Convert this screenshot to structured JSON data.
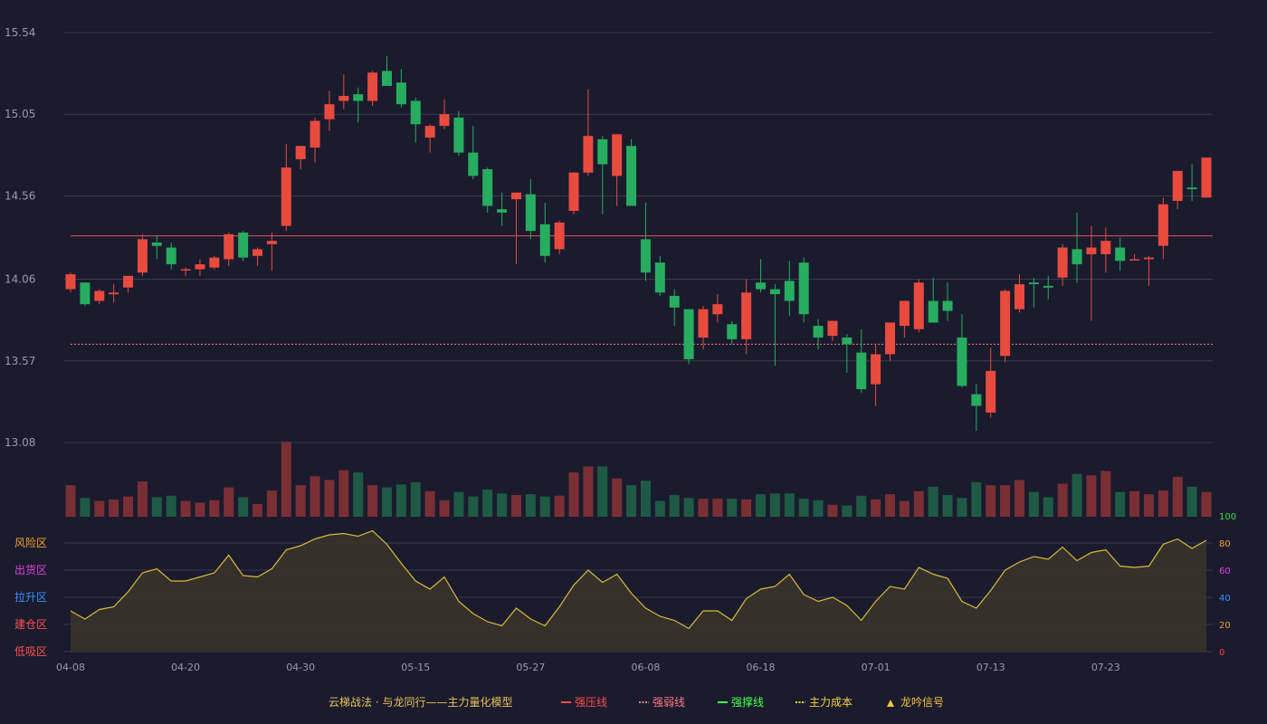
{
  "chart_data": {
    "type": "candlestick",
    "price_axis": {
      "ticks": [
        "15.54",
        "15.05",
        "14.56",
        "14.06",
        "13.57",
        "13.08"
      ],
      "range": [
        13.08,
        15.54
      ]
    },
    "x_tick_labels": [
      "04-08",
      "04-20",
      "04-30",
      "05-15",
      "05-27",
      "06-08",
      "06-18",
      "07-01",
      "07-13",
      "07-23"
    ],
    "x_tick_indices": [
      0,
      8,
      16,
      24,
      32,
      40,
      48,
      56,
      64,
      72
    ],
    "lines": {
      "strong_resistance": 14.32,
      "weak_resistance": 13.67
    },
    "candles": [
      {
        "o": 14.0,
        "h": 14.1,
        "l": 13.98,
        "c": 14.09
      },
      {
        "o": 14.04,
        "h": 14.04,
        "l": 13.9,
        "c": 13.91
      },
      {
        "o": 13.93,
        "h": 14.0,
        "l": 13.91,
        "c": 13.99
      },
      {
        "o": 13.97,
        "h": 14.03,
        "l": 13.92,
        "c": 13.98
      },
      {
        "o": 14.01,
        "h": 14.07,
        "l": 13.98,
        "c": 14.08
      },
      {
        "o": 14.1,
        "h": 14.33,
        "l": 14.08,
        "c": 14.3
      },
      {
        "o": 14.28,
        "h": 14.32,
        "l": 14.18,
        "c": 14.26
      },
      {
        "o": 14.25,
        "h": 14.28,
        "l": 14.12,
        "c": 14.15
      },
      {
        "o": 14.12,
        "h": 14.13,
        "l": 14.08,
        "c": 14.12
      },
      {
        "o": 14.12,
        "h": 14.18,
        "l": 14.08,
        "c": 14.15
      },
      {
        "o": 14.13,
        "h": 14.2,
        "l": 14.12,
        "c": 14.19
      },
      {
        "o": 14.18,
        "h": 14.34,
        "l": 14.14,
        "c": 14.33
      },
      {
        "o": 14.34,
        "h": 14.35,
        "l": 14.17,
        "c": 14.19
      },
      {
        "o": 14.2,
        "h": 14.25,
        "l": 14.14,
        "c": 14.24
      },
      {
        "o": 14.27,
        "h": 14.34,
        "l": 14.11,
        "c": 14.29
      },
      {
        "o": 14.38,
        "h": 14.87,
        "l": 14.35,
        "c": 14.73
      },
      {
        "o": 14.78,
        "h": 14.85,
        "l": 14.72,
        "c": 14.86
      },
      {
        "o": 14.85,
        "h": 15.03,
        "l": 14.76,
        "c": 15.01
      },
      {
        "o": 15.02,
        "h": 15.19,
        "l": 14.95,
        "c": 15.11
      },
      {
        "o": 15.13,
        "h": 15.29,
        "l": 15.08,
        "c": 15.16
      },
      {
        "o": 15.17,
        "h": 15.21,
        "l": 15.0,
        "c": 15.13
      },
      {
        "o": 15.13,
        "h": 15.31,
        "l": 15.1,
        "c": 15.3
      },
      {
        "o": 15.31,
        "h": 15.4,
        "l": 15.23,
        "c": 15.22
      },
      {
        "o": 15.24,
        "h": 15.32,
        "l": 15.09,
        "c": 15.11
      },
      {
        "o": 15.13,
        "h": 15.15,
        "l": 14.88,
        "c": 14.99
      },
      {
        "o": 14.91,
        "h": 14.99,
        "l": 14.82,
        "c": 14.98
      },
      {
        "o": 14.98,
        "h": 15.14,
        "l": 14.96,
        "c": 15.05
      },
      {
        "o": 15.03,
        "h": 15.07,
        "l": 14.8,
        "c": 14.82
      },
      {
        "o": 14.82,
        "h": 14.98,
        "l": 14.66,
        "c": 14.68
      },
      {
        "o": 14.72,
        "h": 14.73,
        "l": 14.46,
        "c": 14.5
      },
      {
        "o": 14.48,
        "h": 14.58,
        "l": 14.38,
        "c": 14.46
      },
      {
        "o": 14.54,
        "h": 14.58,
        "l": 14.15,
        "c": 14.58
      },
      {
        "o": 14.57,
        "h": 14.66,
        "l": 14.3,
        "c": 14.35
      },
      {
        "o": 14.39,
        "h": 14.52,
        "l": 14.16,
        "c": 14.2
      },
      {
        "o": 14.24,
        "h": 14.41,
        "l": 14.21,
        "c": 14.4
      },
      {
        "o": 14.47,
        "h": 14.7,
        "l": 14.45,
        "c": 14.7
      },
      {
        "o": 14.7,
        "h": 15.2,
        "l": 14.68,
        "c": 14.92
      },
      {
        "o": 14.9,
        "h": 14.92,
        "l": 14.45,
        "c": 14.75
      },
      {
        "o": 14.68,
        "h": 14.93,
        "l": 14.5,
        "c": 14.93
      },
      {
        "o": 14.86,
        "h": 14.9,
        "l": 14.5,
        "c": 14.5
      },
      {
        "o": 14.3,
        "h": 14.52,
        "l": 14.05,
        "c": 14.1
      },
      {
        "o": 14.16,
        "h": 14.2,
        "l": 13.96,
        "c": 13.98
      },
      {
        "o": 13.96,
        "h": 14.0,
        "l": 13.78,
        "c": 13.89
      },
      {
        "o": 13.88,
        "h": 13.88,
        "l": 13.55,
        "c": 13.58
      },
      {
        "o": 13.71,
        "h": 13.9,
        "l": 13.64,
        "c": 13.88
      },
      {
        "o": 13.85,
        "h": 13.97,
        "l": 13.8,
        "c": 13.91
      },
      {
        "o": 13.79,
        "h": 13.81,
        "l": 13.67,
        "c": 13.7
      },
      {
        "o": 13.7,
        "h": 14.06,
        "l": 13.61,
        "c": 13.98
      },
      {
        "o": 14.04,
        "h": 14.18,
        "l": 13.98,
        "c": 14.0
      },
      {
        "o": 14.0,
        "h": 14.03,
        "l": 13.54,
        "c": 13.97
      },
      {
        "o": 14.05,
        "h": 14.17,
        "l": 13.84,
        "c": 13.93
      },
      {
        "o": 14.16,
        "h": 14.19,
        "l": 13.8,
        "c": 13.85
      },
      {
        "o": 13.78,
        "h": 13.82,
        "l": 13.64,
        "c": 13.71
      },
      {
        "o": 13.72,
        "h": 13.81,
        "l": 13.69,
        "c": 13.81
      },
      {
        "o": 13.71,
        "h": 13.73,
        "l": 13.5,
        "c": 13.67
      },
      {
        "o": 13.62,
        "h": 13.76,
        "l": 13.38,
        "c": 13.4
      },
      {
        "o": 13.43,
        "h": 13.67,
        "l": 13.3,
        "c": 13.61
      },
      {
        "o": 13.61,
        "h": 13.8,
        "l": 13.57,
        "c": 13.8
      },
      {
        "o": 13.78,
        "h": 13.93,
        "l": 13.71,
        "c": 13.93
      },
      {
        "o": 13.76,
        "h": 14.06,
        "l": 13.74,
        "c": 14.04
      },
      {
        "o": 13.93,
        "h": 14.07,
        "l": 13.8,
        "c": 13.8
      },
      {
        "o": 13.93,
        "h": 14.04,
        "l": 13.81,
        "c": 13.87
      },
      {
        "o": 13.71,
        "h": 13.85,
        "l": 13.41,
        "c": 13.42
      },
      {
        "o": 13.37,
        "h": 13.43,
        "l": 13.15,
        "c": 13.3
      },
      {
        "o": 13.26,
        "h": 13.65,
        "l": 13.23,
        "c": 13.51
      },
      {
        "o": 13.6,
        "h": 14.0,
        "l": 13.56,
        "c": 13.99
      },
      {
        "o": 13.88,
        "h": 14.09,
        "l": 13.86,
        "c": 14.03
      },
      {
        "o": 14.04,
        "h": 14.07,
        "l": 13.89,
        "c": 14.03
      },
      {
        "o": 14.02,
        "h": 14.08,
        "l": 13.94,
        "c": 14.01
      },
      {
        "o": 14.07,
        "h": 14.27,
        "l": 14.02,
        "c": 14.25
      },
      {
        "o": 14.24,
        "h": 14.46,
        "l": 14.04,
        "c": 14.15
      },
      {
        "o": 14.21,
        "h": 14.38,
        "l": 13.81,
        "c": 14.25
      },
      {
        "o": 14.21,
        "h": 14.37,
        "l": 14.1,
        "c": 14.29
      },
      {
        "o": 14.25,
        "h": 14.31,
        "l": 14.11,
        "c": 14.17
      },
      {
        "o": 14.18,
        "h": 14.21,
        "l": 14.18,
        "c": 14.18
      },
      {
        "o": 14.18,
        "h": 14.2,
        "l": 14.02,
        "c": 14.19
      },
      {
        "o": 14.26,
        "h": 14.55,
        "l": 14.18,
        "c": 14.51
      },
      {
        "o": 14.53,
        "h": 14.66,
        "l": 14.48,
        "c": 14.71
      },
      {
        "o": 14.61,
        "h": 14.75,
        "l": 14.53,
        "c": 14.6
      },
      {
        "o": 14.55,
        "h": 14.75,
        "l": 14.55,
        "c": 14.79
      }
    ],
    "volume": [
      0.42,
      0.25,
      0.21,
      0.23,
      0.27,
      0.47,
      0.26,
      0.28,
      0.21,
      0.19,
      0.22,
      0.39,
      0.26,
      0.17,
      0.35,
      1.0,
      0.42,
      0.54,
      0.49,
      0.62,
      0.59,
      0.42,
      0.39,
      0.43,
      0.46,
      0.34,
      0.22,
      0.33,
      0.27,
      0.36,
      0.31,
      0.29,
      0.3,
      0.27,
      0.28,
      0.59,
      0.67,
      0.67,
      0.51,
      0.42,
      0.48,
      0.21,
      0.29,
      0.25,
      0.24,
      0.24,
      0.24,
      0.23,
      0.3,
      0.31,
      0.31,
      0.24,
      0.22,
      0.16,
      0.15,
      0.28,
      0.23,
      0.3,
      0.21,
      0.34,
      0.4,
      0.29,
      0.25,
      0.46,
      0.42,
      0.42,
      0.49,
      0.33,
      0.26,
      0.44,
      0.57,
      0.55,
      0.61,
      0.33,
      0.34,
      0.3,
      0.35,
      0.53,
      0.4,
      0.33,
      0.34
    ],
    "oscillator": {
      "axis_ticks": [
        "100",
        "80",
        "60",
        "40",
        "20",
        "0"
      ],
      "zones": [
        "风险区",
        "出货区",
        "拉升区",
        "建仓区",
        "低吸区"
      ],
      "values": [
        30,
        24,
        31,
        33,
        44,
        58,
        61,
        52,
        52,
        55,
        58,
        71,
        56,
        55,
        61,
        75,
        78,
        83,
        86,
        87,
        85,
        89,
        79,
        65,
        52,
        46,
        55,
        37,
        28,
        22,
        19,
        32,
        24,
        19,
        33,
        49,
        60,
        51,
        57,
        43,
        32,
        26,
        23,
        17,
        30,
        30,
        23,
        39,
        46,
        48,
        57,
        42,
        37,
        40,
        34,
        23,
        37,
        48,
        46,
        62,
        57,
        54,
        37,
        32,
        45,
        60,
        66,
        70,
        68,
        77,
        67,
        73,
        75,
        63,
        62,
        63,
        79,
        83,
        76,
        82
      ],
      "color": "#d9b93c"
    },
    "colors": {
      "up": "#e84b3e",
      "down": "#27ad5f",
      "vol_up": "#7a2f35",
      "vol_down": "#1e5a45"
    }
  },
  "legend": {
    "title": "云梯战法 · 与龙同行——主力量化模型",
    "items": [
      {
        "label": "强压线",
        "color": "#ff4d4d",
        "style": "solid"
      },
      {
        "label": "强弱线",
        "color": "#ff7a85",
        "style": "dashed"
      },
      {
        "label": "强撑线",
        "color": "#4dff4d",
        "style": "solid"
      },
      {
        "label": "主力成本",
        "color": "#f6d23c",
        "style": "dashed"
      },
      {
        "label": "龙吟信号",
        "color": "#f6c23c",
        "style": "triangle"
      }
    ]
  }
}
